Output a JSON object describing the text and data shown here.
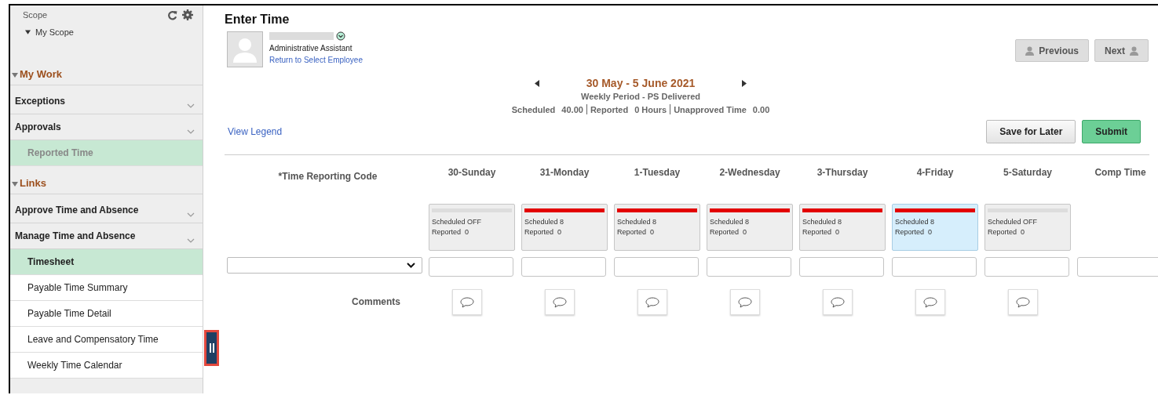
{
  "sidebar": {
    "scope": {
      "label": "Scope",
      "tree_item": {
        "label": "My Scope",
        "expanded": true
      }
    },
    "sections": [
      {
        "title": "My Work",
        "expanded": true,
        "items": [
          {
            "kind": "group",
            "label": "Exceptions"
          },
          {
            "kind": "group",
            "label": "Approvals"
          },
          {
            "kind": "link",
            "label": "Reported Time",
            "selected": true,
            "disabled": true
          }
        ]
      },
      {
        "title": "Links",
        "expanded": true,
        "items": [
          {
            "kind": "group",
            "label": "Approve Time and Absence"
          },
          {
            "kind": "group",
            "label": "Manage Time and Absence"
          },
          {
            "kind": "link",
            "label": "Timesheet",
            "selected": true,
            "disabled": false
          },
          {
            "kind": "link",
            "label": "Payable Time Summary",
            "selected": false,
            "disabled": false
          },
          {
            "kind": "link",
            "label": "Payable Time Detail",
            "selected": false,
            "disabled": false
          },
          {
            "kind": "link",
            "label": "Leave and Compensatory Time",
            "selected": false,
            "disabled": false
          },
          {
            "kind": "link",
            "label": "Weekly Time Calendar",
            "selected": false,
            "disabled": false
          }
        ]
      }
    ]
  },
  "page": {
    "title": "Enter Time",
    "employee": {
      "job_title": "Administrative Assistant",
      "return_link": "Return to Select Employee"
    },
    "nav_buttons": [
      {
        "label": "Previous",
        "icon_before_label": true
      },
      {
        "label": "Next",
        "icon_before_label": false
      }
    ],
    "period": {
      "range": "30 May - 5 June 2021",
      "type": "Weekly Period - PS Delivered",
      "summary": [
        {
          "label": "Scheduled",
          "value": "40.00"
        },
        {
          "label": "Reported",
          "value": "0 Hours"
        },
        {
          "label": "Unapproved Time",
          "value": "0.00"
        }
      ]
    },
    "legend_link": "View Legend",
    "actions": [
      {
        "label": "Save for Later",
        "kind": "secondary"
      },
      {
        "label": "Submit",
        "kind": "primary"
      }
    ]
  },
  "timesheet": {
    "code_header": "*Time Reporting Code",
    "comments_label": "Comments",
    "days": [
      {
        "label": "30-Sunday",
        "scheduled": "Scheduled OFF",
        "reported": "Reported  0",
        "color": "#dddddd",
        "current": false
      },
      {
        "label": "31-Monday",
        "scheduled": "Scheduled 8",
        "reported": "Reported  0",
        "color": "#e30000",
        "current": false
      },
      {
        "label": "1-Tuesday",
        "scheduled": "Scheduled 8",
        "reported": "Reported  0",
        "color": "#e30000",
        "current": false
      },
      {
        "label": "2-Wednesday",
        "scheduled": "Scheduled 8",
        "reported": "Reported  0",
        "color": "#e30000",
        "current": false
      },
      {
        "label": "3-Thursday",
        "scheduled": "Scheduled 8",
        "reported": "Reported  0",
        "color": "#e30000",
        "current": false
      },
      {
        "label": "4-Friday",
        "scheduled": "Scheduled 8",
        "reported": "Reported  0",
        "color": "#e30000",
        "current": true
      },
      {
        "label": "5-Saturday",
        "scheduled": "Scheduled OFF",
        "reported": "Reported  0",
        "color": "#dddddd",
        "current": false
      }
    ],
    "extra_column": "Comp Time"
  }
}
